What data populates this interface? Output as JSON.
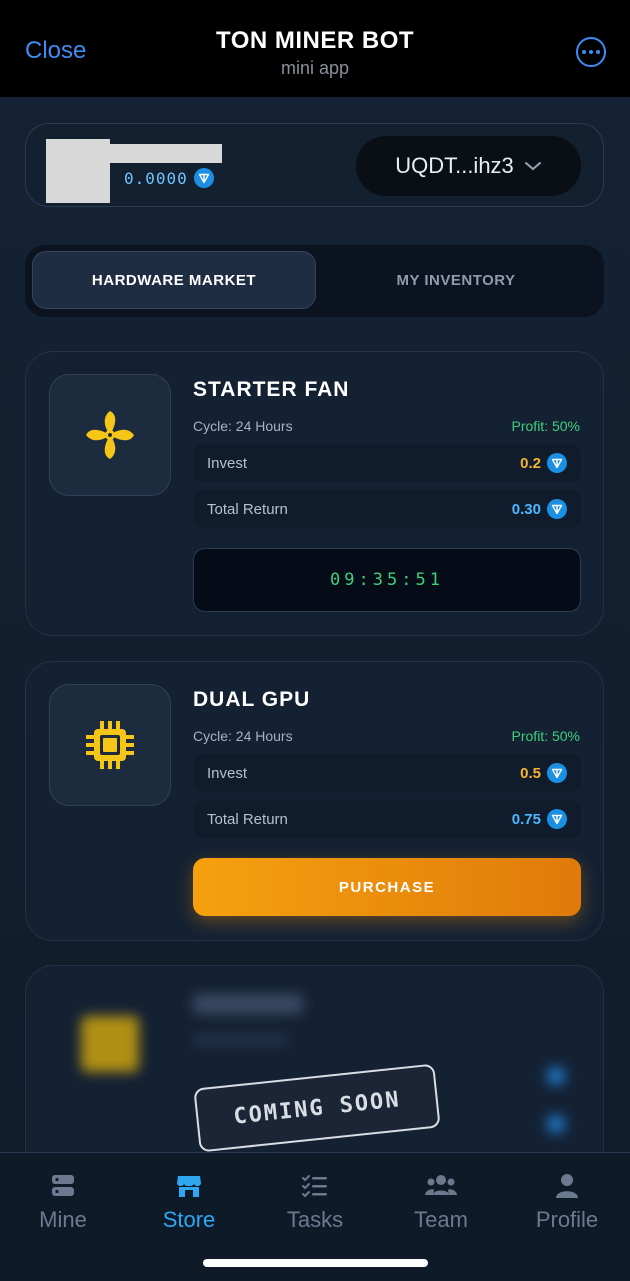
{
  "header": {
    "close_label": "Close",
    "title": "TON MINER BOT",
    "subtitle": "mini app"
  },
  "wallet": {
    "balance": "0.0000",
    "address": "UQDT...ihz3"
  },
  "tabs": [
    {
      "label": "HARDWARE MARKET"
    },
    {
      "label": "MY INVENTORY"
    }
  ],
  "items": [
    {
      "name": "STARTER FAN",
      "cycle": "Cycle: 24 Hours",
      "profit": "Profit: 50%",
      "invest_label": "Invest",
      "invest_value": "0.2",
      "return_label": "Total Return",
      "return_value": "0.30",
      "timer": "09:35:51"
    },
    {
      "name": "DUAL GPU",
      "cycle": "Cycle: 24 Hours",
      "profit": "Profit: 50%",
      "invest_label": "Invest",
      "invest_value": "0.5",
      "return_label": "Total Return",
      "return_value": "0.75",
      "button": "PURCHASE"
    }
  ],
  "locked": {
    "badge": "COMING SOON"
  },
  "nav": [
    {
      "label": "Mine",
      "icon": "server-icon"
    },
    {
      "label": "Store",
      "icon": "store-icon",
      "active": true
    },
    {
      "label": "Tasks",
      "icon": "tasks-icon"
    },
    {
      "label": "Team",
      "icon": "team-icon"
    },
    {
      "label": "Profile",
      "icon": "profile-icon"
    }
  ],
  "colors": {
    "accent": "#2ea7f0",
    "gold": "#f5b52e",
    "profit": "#3ecf7a",
    "purchase": "#f6a10f"
  }
}
